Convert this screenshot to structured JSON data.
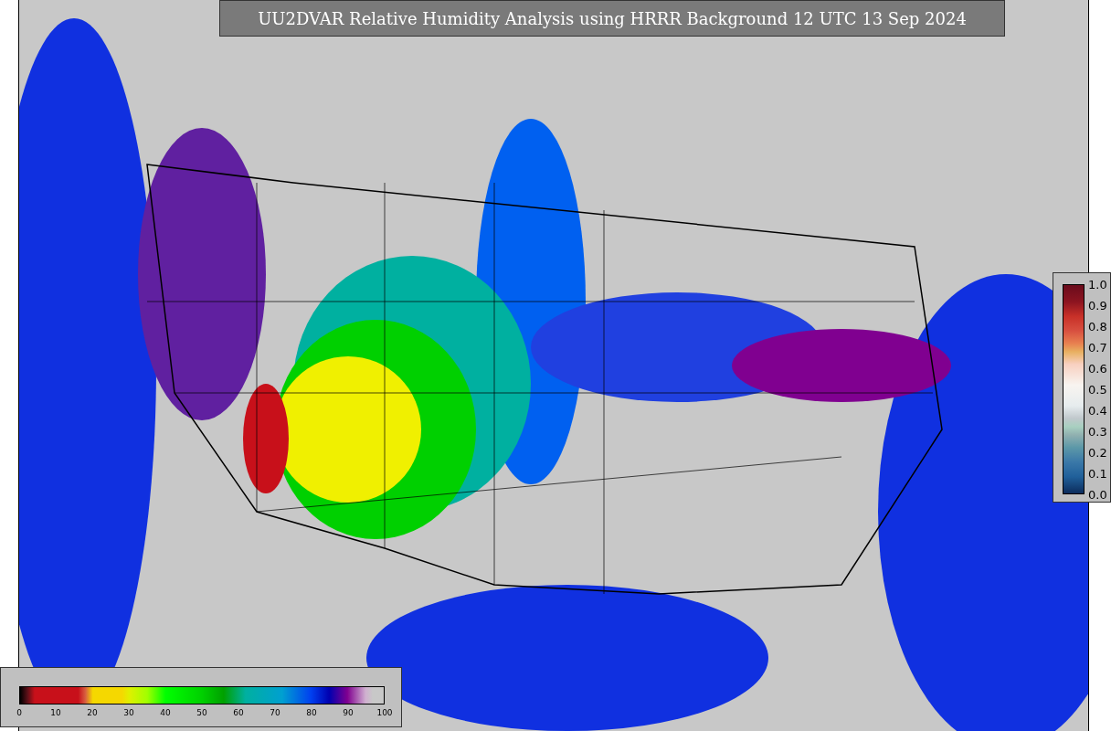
{
  "title": "UU2DVAR Relative Humidity Analysis using HRRR Background 12 UTC 13 Sep 2024",
  "humidity_legend": {
    "ticks": [
      "0",
      "10",
      "20",
      "30",
      "40",
      "50",
      "60",
      "70",
      "80",
      "90",
      "100"
    ]
  },
  "ratio_legend": {
    "ticks": [
      "1.0",
      "0.9",
      "0.8",
      "0.7",
      "0.6",
      "0.5",
      "0.4",
      "0.3",
      "0.2",
      "0.1",
      "0.0"
    ]
  }
}
